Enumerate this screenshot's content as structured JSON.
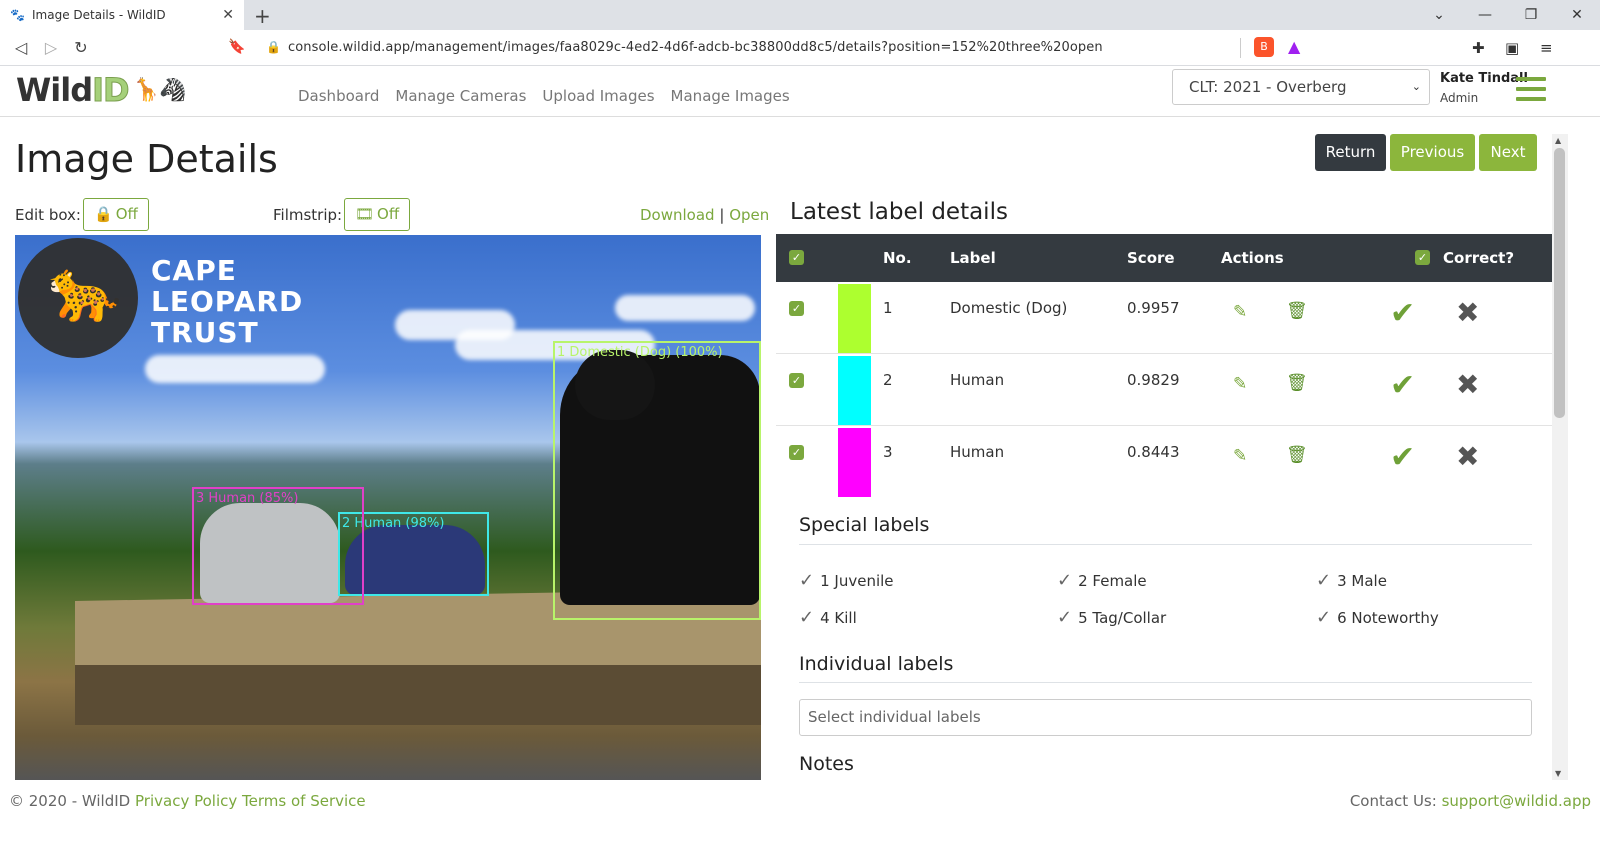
{
  "browser": {
    "tab_title": "Image Details - WildID",
    "url": "console.wildid.app/management/images/faa8029c-4ed2-4d6f-adcb-bc38800dd8c5/details?position=152%20three%20open"
  },
  "site": {
    "logo_main": "Wild",
    "logo_accent": "ID",
    "nav": [
      "Dashboard",
      "Manage Cameras",
      "Upload Images",
      "Manage Images"
    ],
    "project_selected": "CLT: 2021 - Overberg",
    "user_name": "Kate Tindall",
    "user_role": "Admin"
  },
  "page": {
    "title": "Image Details",
    "buttons": {
      "return": "Return",
      "previous": "Previous",
      "next": "Next"
    },
    "edit_box_label": "Edit box:",
    "edit_box_state": "Off",
    "filmstrip_label": "Filmstrip:",
    "filmstrip_state": "Off",
    "download_link": "Download",
    "link_sep": "|",
    "open_link": "Open"
  },
  "photo": {
    "org_lines": [
      "CAPE",
      "LEOPARD",
      "TRUST"
    ],
    "boxes": [
      {
        "label": "1 Domestic (Dog) (100%)",
        "color": "#b8f46a"
      },
      {
        "label": "2 Human (98%)",
        "color": "#3fe8e8"
      },
      {
        "label": "3 Human (85%)",
        "color": "#e040c8"
      }
    ]
  },
  "labels": {
    "title": "Latest label details",
    "headers": {
      "no": "No.",
      "label": "Label",
      "score": "Score",
      "actions": "Actions",
      "correct": "Correct?"
    },
    "rows": [
      {
        "no": "1",
        "label": "Domestic (Dog)",
        "score": "0.9957",
        "color": "#adff2f"
      },
      {
        "no": "2",
        "label": "Human",
        "score": "0.9829",
        "color": "#00ffff"
      },
      {
        "no": "3",
        "label": "Human",
        "score": "0.8443",
        "color": "#ff00ff"
      }
    ]
  },
  "special": {
    "heading": "Special labels",
    "items": [
      "1 Juvenile",
      "2 Female",
      "3 Male",
      "4 Kill",
      "5 Tag/Collar",
      "6 Noteworthy"
    ]
  },
  "individual": {
    "heading": "Individual labels",
    "placeholder": "Select individual labels"
  },
  "notes": {
    "heading": "Notes"
  },
  "footer": {
    "copyright": "© 2020 - WildID",
    "privacy": "Privacy Policy",
    "terms": "Terms of Service",
    "contact_label": "Contact Us:",
    "contact_email": "support@wildid.app"
  }
}
